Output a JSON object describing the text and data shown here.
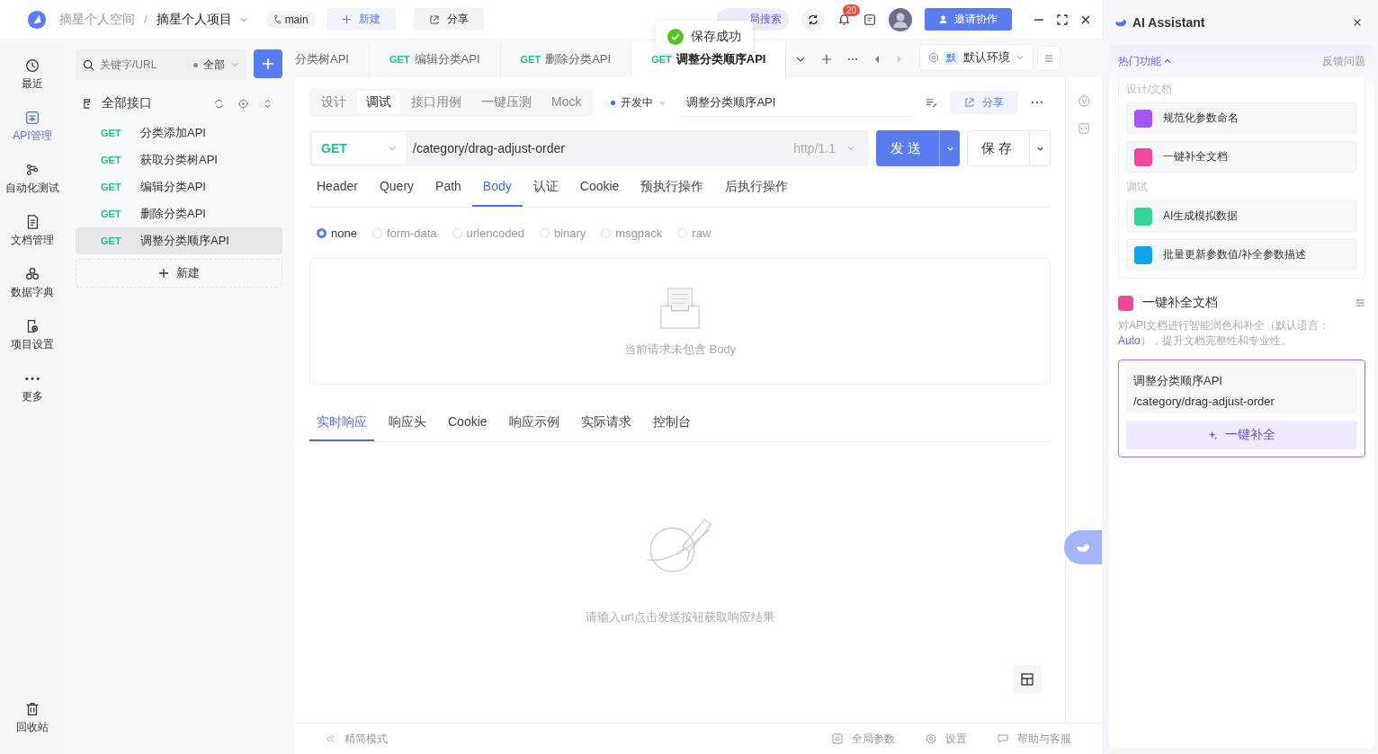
{
  "header": {
    "breadcrumb": [
      "摘星个人空间",
      "摘星个人项目"
    ],
    "separator": "/",
    "branch": "main",
    "new_button": "新建",
    "share_button": "分享",
    "search_button": "局搜索",
    "notification_count": "20",
    "invite_button": "邀请协作"
  },
  "toast": "保存成功",
  "nav": [
    {
      "kind": "history",
      "label": "最近",
      "selected": false
    },
    {
      "kind": "api",
      "label": "API管理",
      "selected": true
    },
    {
      "kind": "flow",
      "label": "自动化测试",
      "selected": false
    },
    {
      "kind": "doc",
      "label": "文档管理",
      "selected": false
    },
    {
      "kind": "dict",
      "label": "数据字典",
      "selected": false
    },
    {
      "kind": "settings",
      "label": "项目设置",
      "selected": false
    },
    {
      "kind": "more",
      "label": "更多",
      "selected": false
    }
  ],
  "nav_bottom": "回收站",
  "tree": {
    "search_placeholder": "关键字/URL",
    "filter": "全部",
    "root": "全部接口",
    "new_button": "新建",
    "items": [
      {
        "method": "GET",
        "name": "分类添加API",
        "selected": false
      },
      {
        "method": "GET",
        "name": "获取分类树API",
        "selected": false
      },
      {
        "method": "GET",
        "name": "编辑分类API",
        "selected": false
      },
      {
        "method": "GET",
        "name": "删除分类API",
        "selected": false
      },
      {
        "method": "GET",
        "name": "调整分类顺序API",
        "selected": true
      }
    ]
  },
  "tabs": [
    {
      "name": "分类树API",
      "selected": false
    },
    {
      "method": "GET",
      "name": "编辑分类API",
      "selected": false
    },
    {
      "method": "GET",
      "name": "删除分类API",
      "selected": false
    },
    {
      "method": "GET",
      "name": "调整分类顺序API",
      "selected": true
    }
  ],
  "environment": {
    "badge": "默",
    "name": "默认环境"
  },
  "mode_tabs": [
    {
      "label": "设计",
      "selected": false
    },
    {
      "label": "调试",
      "selected": true
    },
    {
      "label": "接口用例",
      "selected": false
    },
    {
      "label": "一键压测",
      "selected": false
    },
    {
      "label": "Mock",
      "selected": false
    }
  ],
  "status": "开发中",
  "api_name": "调整分类顺序API",
  "share_button": "分享",
  "request": {
    "method": "GET",
    "url": "/category/drag-adjust-order",
    "protocol": "http/1.1",
    "send": "发送",
    "save": "保存"
  },
  "param_tabs": [
    {
      "label": "Header",
      "selected": false
    },
    {
      "label": "Query",
      "selected": false
    },
    {
      "label": "Path",
      "selected": false
    },
    {
      "label": "Body",
      "selected": true
    },
    {
      "label": "认证",
      "selected": false
    },
    {
      "label": "Cookie",
      "selected": false
    },
    {
      "label": "预执行操作",
      "selected": false
    },
    {
      "label": "后执行操作",
      "selected": false
    }
  ],
  "body_types": [
    {
      "label": "none",
      "selected": true
    },
    {
      "label": "form-data",
      "selected": false
    },
    {
      "label": "urlencoded",
      "selected": false
    },
    {
      "label": "binary",
      "selected": false
    },
    {
      "label": "msgpack",
      "selected": false
    },
    {
      "label": "raw",
      "selected": false
    }
  ],
  "body_empty": "当前请求未包含 Body",
  "response_tabs": [
    {
      "label": "实时响应",
      "selected": true
    },
    {
      "label": "响应头",
      "selected": false
    },
    {
      "label": "Cookie",
      "selected": false
    },
    {
      "label": "响应示例",
      "selected": false
    },
    {
      "label": "实际请求",
      "selected": false
    },
    {
      "label": "控制台",
      "selected": false
    }
  ],
  "response_empty": "请输入url点击发送按钮获取响应结果",
  "footer": {
    "compact": "精简模式",
    "items": [
      {
        "kind": "params",
        "label": "全局参数"
      },
      {
        "kind": "settings",
        "label": "设置"
      },
      {
        "kind": "help",
        "label": "帮助与客服"
      }
    ]
  },
  "ai": {
    "title": "AI Assistant",
    "hot": "热门功能",
    "expanded": true,
    "feedback": "反馈问题",
    "groups": [
      {
        "title": "设计/文档",
        "items": [
          {
            "label": "规范化参数命名",
            "color": "#a855f7"
          },
          {
            "label": "一键补全文档",
            "color": "#ec4899"
          }
        ]
      },
      {
        "title": "调试",
        "items": [
          {
            "label": "AI生成模拟数据",
            "color": "#34d399"
          },
          {
            "label": "批量更新参数值/补全参数描述",
            "color": "#0ea5e9"
          }
        ]
      }
    ],
    "feature": {
      "title": "一键补全文档",
      "description": "对API文档进行智能润色和补全（默认语言：",
      "link": "Auto",
      "description_end": "），提升文档完整性和专业性。"
    },
    "card": {
      "name": "调整分类顺序API",
      "path": "/category/drag-adjust-order",
      "button": "一键补全"
    }
  }
}
